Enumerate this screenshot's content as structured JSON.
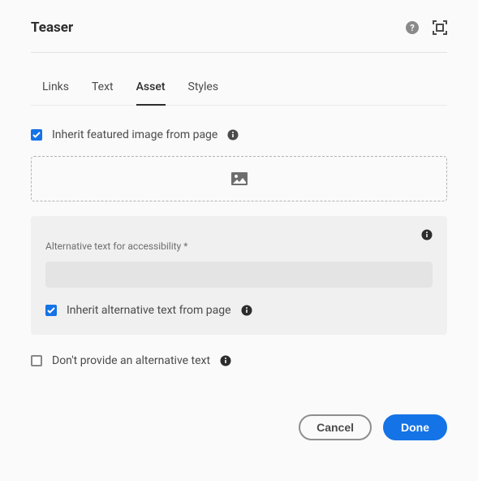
{
  "title": "Teaser",
  "tabs": [
    {
      "label": "Links"
    },
    {
      "label": "Text"
    },
    {
      "label": "Asset"
    },
    {
      "label": "Styles"
    }
  ],
  "inheritImage": {
    "label": "Inherit featured image from page"
  },
  "altPanel": {
    "field_label": "Alternative text for accessibility *",
    "value": "",
    "inherit_label": "Inherit alternative text from page"
  },
  "noAlt": {
    "label": "Don't provide an alternative text"
  },
  "buttons": {
    "cancel": "Cancel",
    "done": "Done"
  }
}
